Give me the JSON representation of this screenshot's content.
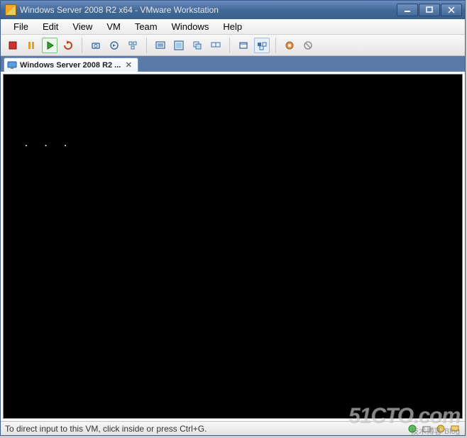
{
  "titlebar": {
    "title": "Windows Server 2008 R2 x64 - VMware Workstation"
  },
  "menu": {
    "items": [
      "File",
      "Edit",
      "View",
      "VM",
      "Team",
      "Windows",
      "Help"
    ]
  },
  "toolbar": {
    "icons": [
      "power-off",
      "pause",
      "play",
      "reset",
      "|",
      "snapshot-take",
      "snapshot-revert",
      "snapshot-manager",
      "|",
      "show-console",
      "full-screen",
      "unity",
      "multi-monitor",
      "|",
      "current-view",
      "quick-switch",
      "|",
      "capture-input",
      "release-input"
    ]
  },
  "tab": {
    "label": "Windows Server 2008 R2 ..."
  },
  "vm": {
    "console_text": ". . ."
  },
  "status": {
    "message": "To direct input to this VM, click inside or press Ctrl+G."
  },
  "watermark": {
    "main": "51CTO.com",
    "sub": "技术博客  Blog"
  }
}
